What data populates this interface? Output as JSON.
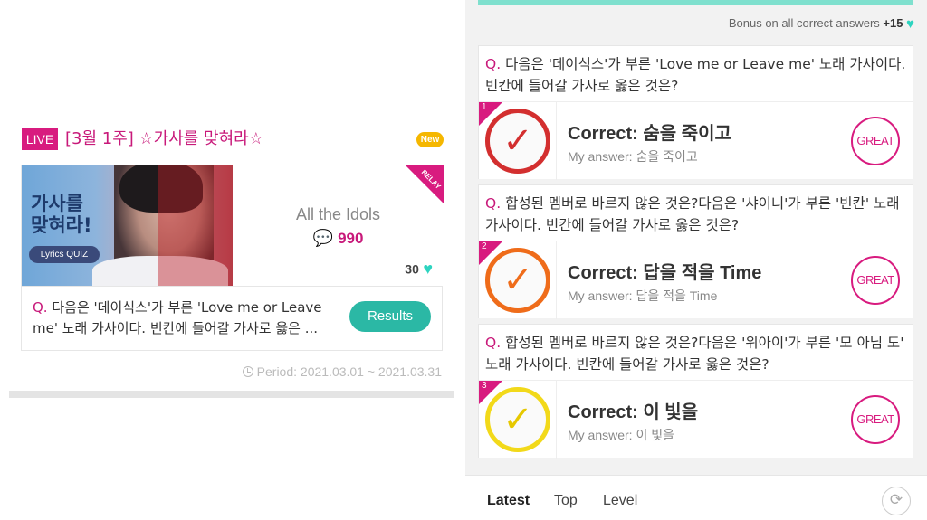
{
  "left": {
    "live_badge": "LIVE",
    "title": "[3월 1주] ☆가사를 맞혀라☆",
    "new_badge": "New",
    "thumbnail": {
      "title_line1": "가사를",
      "title_line2": "맞혀라!",
      "subtitle": "Lyrics QUIZ"
    },
    "relay_label": "RELAY",
    "artist_name": "All the Idols",
    "comment_icon": "comment-icon",
    "comment_count": "990",
    "heart_count": "30",
    "question_prefix": "Q.",
    "question": "다음은 '데이식스'가 부른 'Love me or Leave me' 노래 가사이다. 빈칸에 들어갈 가사로 옳은 ...",
    "results_button": "Results",
    "period": "Period: 2021.03.01 ~ 2021.03.31"
  },
  "right": {
    "bonus_text": "Bonus on all correct answers",
    "bonus_points": "+15",
    "answers": [
      {
        "number": "1",
        "question_prefix": "Q.",
        "question": "다음은 '데이식스'가 부른 'Love me or Leave me' 노래 가사이다. 빈칸에 들어갈 가사로 옳은 것은?",
        "correct": "Correct: 숨을 죽이고",
        "my_answer": "My answer: 숨을 죽이고",
        "badge": "GREAT",
        "check_color": "#d32f2f"
      },
      {
        "number": "2",
        "question_prefix": "Q.",
        "question": "합성된 멤버로 바르지 않은 것은?다음은 '샤이니'가 부른 '빈칸' 노래 가사이다. 빈칸에 들어갈 가사로 옳은 것은?",
        "correct": "Correct: 답을 적을 Time",
        "my_answer": "My answer: 답을 적을 Time",
        "badge": "GREAT",
        "check_color": "#ef6c1a"
      },
      {
        "number": "3",
        "question_prefix": "Q.",
        "question": "합성된 멤버로 바르지 않은 것은?다음은 '위아이'가 부른 '모 아님 도' 노래 가사이다. 빈칸에 들어갈 가사로 옳은 것은?",
        "correct": "Correct: 이 빛을",
        "my_answer": "My answer: 이 빛을",
        "badge": "GREAT",
        "check_color": "#f2d91a"
      }
    ],
    "nav": {
      "latest": "Latest",
      "top": "Top",
      "level": "Level"
    }
  },
  "colors": {
    "accent_pink": "#d81b7f",
    "teal": "#2bb8a5",
    "heart": "#2dd4c0"
  }
}
